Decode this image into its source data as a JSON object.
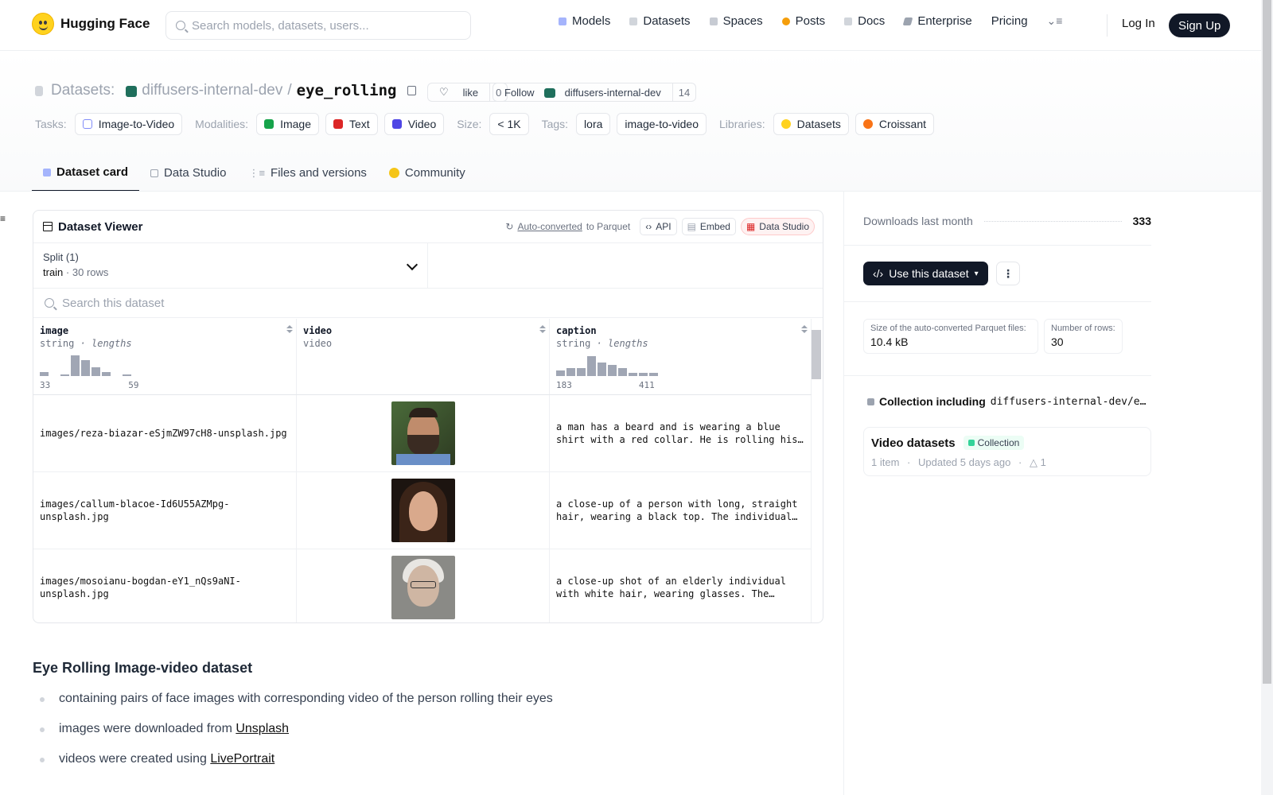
{
  "nav": {
    "brand": "Hugging Face",
    "search_placeholder": "Search models, datasets, users...",
    "links": [
      "Models",
      "Datasets",
      "Spaces",
      "Posts",
      "Docs",
      "Enterprise",
      "Pricing"
    ],
    "login": "Log In",
    "signup": "Sign Up"
  },
  "repo": {
    "section": "Datasets:",
    "org": "diffusers-internal-dev",
    "sep": "/",
    "name": "eye_rolling",
    "like_label": "like",
    "like_count": "0",
    "follow_label": "Follow",
    "follow_org": "diffusers-internal-dev",
    "follow_count": "14"
  },
  "tags": {
    "tasks_label": "Tasks:",
    "task": "Image-to-Video",
    "modalities_label": "Modalities:",
    "modalities": [
      "Image",
      "Text",
      "Video"
    ],
    "size_label": "Size:",
    "size": "< 1K",
    "tags_label": "Tags:",
    "tags": [
      "lora",
      "image-to-video"
    ],
    "libraries_label": "Libraries:",
    "libraries": [
      "Datasets",
      "Croissant"
    ]
  },
  "tabs": [
    "Dataset card",
    "Data Studio",
    "Files and versions",
    "Community"
  ],
  "viewer": {
    "title": "Dataset Viewer",
    "auto_converted": "Auto-converted",
    "to_parquet": "to Parquet",
    "api": "API",
    "embed": "Embed",
    "data_studio": "Data Studio",
    "split_label": "Split (1)",
    "split_value": "train",
    "split_dot": "·",
    "split_rows": "30 rows",
    "search_placeholder": "Search this dataset",
    "columns": [
      {
        "name": "image",
        "type": "string",
        "type_extra": "· lengths",
        "min": "33",
        "max": "59"
      },
      {
        "name": "video",
        "type": "video",
        "type_extra": "",
        "min": "",
        "max": ""
      },
      {
        "name": "caption",
        "type": "string",
        "type_extra": "· lengths",
        "min": "183",
        "max": "411"
      }
    ],
    "rows": [
      {
        "image": "images/reza-biazar-eSjmZW97cH8-unsplash.jpg",
        "caption": "a man has a beard and is wearing a blue shirt with a red collar. He is rolling his eyes and looking up."
      },
      {
        "image": "images/callum-blacoe-Id6U55AZMpg-unsplash.jpg",
        "caption": "a close-up of a person with long, straight hair, wearing a black top. The individual is rolling their eyes."
      },
      {
        "image": "images/mosoianu-bogdan-eY1_nQs9aNI-unsplash.jpg",
        "caption": "a close-up shot of an elderly individual with white hair, wearing glasses. The person rolls their eyes."
      }
    ]
  },
  "readme": {
    "title": "Eye Rolling Image-video dataset",
    "items": [
      {
        "text": "containing pairs of face images with corresponding video of the person rolling their eyes",
        "link": ""
      },
      {
        "text": "images were downloaded from ",
        "link": "Unsplash"
      },
      {
        "text": "videos were created using ",
        "link": "LivePortrait"
      }
    ]
  },
  "sidebar": {
    "downloads_label": "Downloads last month",
    "downloads": "333",
    "use_button": "Use this dataset",
    "parquet_label": "Size of the auto-converted Parquet files:",
    "parquet_size": "10.4 kB",
    "rows_label": "Number of rows:",
    "rows": "30",
    "collection_label": "Collection including",
    "collection_repo": "diffusers-internal-dev/e…",
    "collection_title": "Video datasets",
    "collection_badge": "Collection",
    "collection_items": "1 item",
    "collection_updated": "Updated 5 days ago",
    "collection_upvotes": "1"
  },
  "colors": {
    "accent": "#111827",
    "logo": "#ffd21e",
    "org": "#1f6f5c"
  }
}
